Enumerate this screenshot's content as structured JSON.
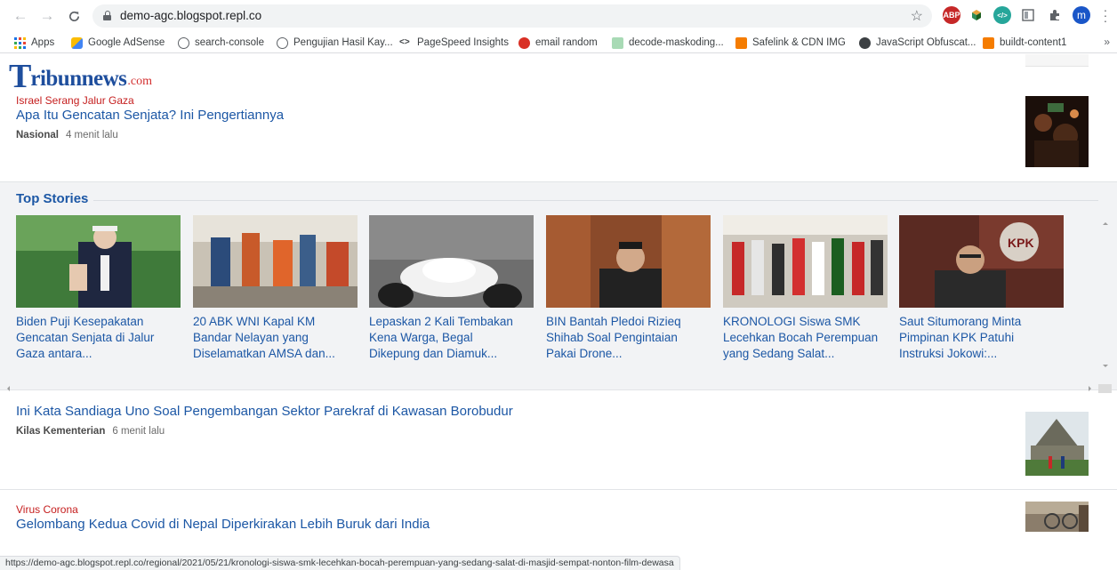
{
  "browser": {
    "url": "demo-agc.blogspot.repl.co",
    "profile_initial": "m",
    "bookmarks": [
      {
        "label": "Apps",
        "color": "#c5221f"
      },
      {
        "label": "Google AdSense",
        "color": "#fbbc04"
      },
      {
        "label": "search-console",
        "color": "#5f6368"
      },
      {
        "label": "Pengujian Hasil Kay...",
        "color": "#5f6368"
      },
      {
        "label": "PageSpeed Insights",
        "color": "#3c4043"
      },
      {
        "label": "email random",
        "color": "#d93025"
      },
      {
        "label": "decode-maskoding...",
        "color": "#a8dab5"
      },
      {
        "label": "Safelink & CDN IMG",
        "color": "#f57c00"
      },
      {
        "label": "JavaScript Obfuscat...",
        "color": "#3c4043"
      },
      {
        "label": "buildt-content1",
        "color": "#f57c00"
      }
    ],
    "status_url": "https://demo-agc.blogspot.repl.co/regional/2021/05/21/kronologi-siswa-smk-lecehkan-bocah-perempuan-yang-sedang-salat-di-masjid-sempat-nonton-film-dewasa"
  },
  "site": {
    "logo_t": "T",
    "logo_rest": "ribunnews",
    "logo_com": ".com"
  },
  "articles": [
    {
      "kicker": "Israel Serang Jalur Gaza",
      "title": "Apa Itu Gencatan Senjata? Ini Pengertiannya",
      "category": "Nasional",
      "time": "4 menit lalu"
    },
    {
      "kicker": "",
      "title": "Ini Kata Sandiaga Uno Soal Pengembangan Sektor Parekraf di Kawasan Borobudur",
      "category": "Kilas Kementerian",
      "time": "6 menit lalu"
    },
    {
      "kicker": "Virus Corona",
      "title": "Gelombang Kedua Covid di Nepal Diperkirakan Lebih Buruk dari India",
      "category": "",
      "time": ""
    }
  ],
  "top_stories": {
    "title": "Top Stories",
    "items": [
      {
        "line1": "Biden Puji Kesepakatan",
        "line2": "Gencatan Senjata di Jalur",
        "line3": "Gaza antara..."
      },
      {
        "line1": "20 ABK WNI Kapal KM",
        "line2": "Bandar Nelayan yang",
        "line3": "Diselamatkan AMSA dan..."
      },
      {
        "line1": "Lepaskan 2 Kali Tembakan",
        "line2": "Kena Warga, Begal",
        "line3": "Dikepung dan Diamuk..."
      },
      {
        "line1": "BIN Bantah Pledoi Rizieq",
        "line2": "Shihab Soal Pengintaian",
        "line3": "Pakai Drone..."
      },
      {
        "line1": "KRONOLOGI Siswa SMK",
        "line2": "Lecehkan Bocah Perempuan",
        "line3": "yang Sedang Salat..."
      },
      {
        "line1": "Saut Situmorang Minta",
        "line2": "Pimpinan KPK Patuhi",
        "line3": "Instruksi Jokowi:..."
      }
    ]
  }
}
